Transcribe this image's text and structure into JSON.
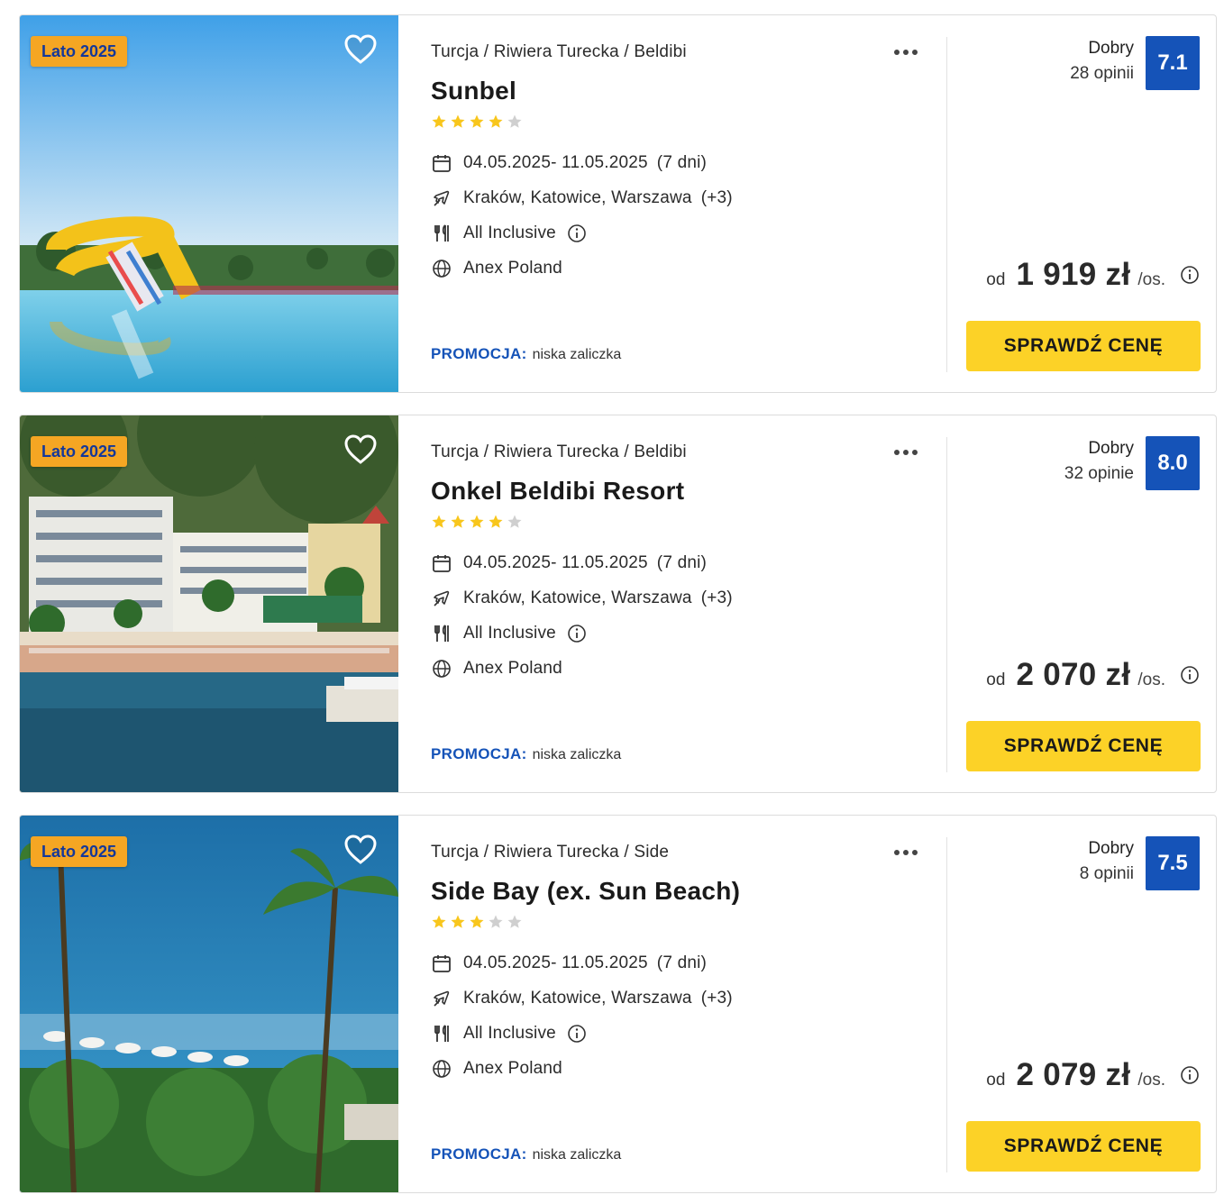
{
  "offers": [
    {
      "season_badge": "Lato 2025",
      "breadcrumb": "Turcja / Riwiera Turecka / Beldibi",
      "hotel_name": "Sunbel",
      "stars": 4,
      "dates": "04.05.2025- 11.05.2025",
      "duration": "(7 dni)",
      "departures": "Kraków, Katowice, Warszawa",
      "departures_extra": "(+3)",
      "board": "All Inclusive",
      "operator": "Anex Poland",
      "promo_label": "PROMOCJA:",
      "promo_text": "niska zaliczka",
      "rating_label": "Dobry",
      "rating_count": "28 opinii",
      "rating_score": "7.1",
      "price_prefix": "od",
      "price": "1 919 zł",
      "price_suffix": "/os.",
      "cta": "SPRAWDŹ CENĘ"
    },
    {
      "season_badge": "Lato 2025",
      "breadcrumb": "Turcja / Riwiera Turecka / Beldibi",
      "hotel_name": "Onkel Beldibi Resort",
      "stars": 4,
      "dates": "04.05.2025- 11.05.2025",
      "duration": "(7 dni)",
      "departures": "Kraków, Katowice, Warszawa",
      "departures_extra": "(+3)",
      "board": "All Inclusive",
      "operator": "Anex Poland",
      "promo_label": "PROMOCJA:",
      "promo_text": "niska zaliczka",
      "rating_label": "Dobry",
      "rating_count": "32 opinie",
      "rating_score": "8.0",
      "price_prefix": "od",
      "price": "2 070 zł",
      "price_suffix": "/os.",
      "cta": "SPRAWDŹ CENĘ"
    },
    {
      "season_badge": "Lato 2025",
      "breadcrumb": "Turcja / Riwiera Turecka / Side",
      "hotel_name": "Side Bay (ex. Sun Beach)",
      "stars": 3,
      "dates": "04.05.2025- 11.05.2025",
      "duration": "(7 dni)",
      "departures": "Kraków, Katowice, Warszawa",
      "departures_extra": "(+3)",
      "board": "All Inclusive",
      "operator": "Anex Poland",
      "promo_label": "PROMOCJA:",
      "promo_text": "niska zaliczka",
      "rating_label": "Dobry",
      "rating_count": "8 opinii",
      "rating_score": "7.5",
      "price_prefix": "od",
      "price": "2 079 zł",
      "price_suffix": "/os.",
      "cta": "SPRAWDŹ CENĘ"
    }
  ],
  "icons": {
    "favorite": "heart-outline-icon",
    "more": "ellipsis-icon",
    "star": "star-icon",
    "calendar": "calendar-icon",
    "flight": "plane-icon",
    "board": "cutlery-icon",
    "info": "info-icon",
    "operator": "globe-icon"
  },
  "colors": {
    "badge": "#f5a623",
    "badge_text": "#14389a",
    "score_bg": "#1553b8",
    "promo": "#1553b8",
    "cta": "#fcd227",
    "star_on": "#f8c61c",
    "star_off": "#cfcfcf"
  }
}
